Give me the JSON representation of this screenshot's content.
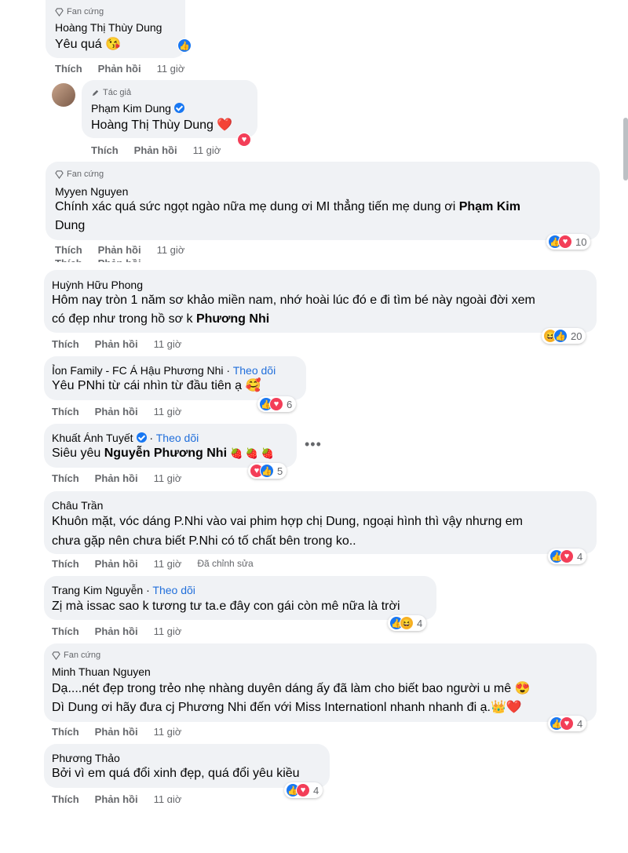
{
  "labels": {
    "like": "Thích",
    "reply": "Phản hồi",
    "follow": "Theo dõi",
    "edited": "Đã chỉnh sửa"
  },
  "comments": [
    {
      "badge": "Fan cứng",
      "name": "Hoàng Thị Thùy Dung",
      "text": "Yêu quá 😘",
      "time": "11 giờ"
    },
    {
      "badge": "Tác giả",
      "name": "Phạm Kim Dung",
      "text": "Hoàng Thị Thùy Dung ❤️",
      "time": "11 giờ"
    },
    {
      "badge": "Fan cứng",
      "name": "Myyen Nguyen",
      "text_line1": "Chính xác quá sức ngọt ngào nữa mẹ dung ơi MI thẳng tiến mẹ dung ơi ",
      "text_mention": "Phạm Kim",
      "text_line2": "Dung",
      "time": "11 giờ",
      "reactions": "10"
    },
    {
      "name": "Huỳnh Hữu Phong",
      "text_line1": "Hôm nay tròn 1 năm sơ khảo miền nam, nhớ hoài lúc đó e đi tìm bé này ngoài đời xem",
      "text_line2": "có đẹp như trong hồ sơ k ",
      "text_mention": "Phương Nhi",
      "time": "11 giờ",
      "reactions": "20"
    },
    {
      "name": "Ỉon Family - FC Á Hậu Phương Nhi",
      "text": "Yêu PNhi từ cái nhìn từ đầu tiên ạ 🥰",
      "time": "11 giờ",
      "reactions": "6"
    },
    {
      "name": "Khuất Ánh Tuyết",
      "text": "Siêu yêu ",
      "text_mention": "Nguyễn Phương Nhi",
      "text_emoji": "🍓 🍓 🍓",
      "time": "11 giờ",
      "reactions": "5"
    },
    {
      "name": "Châu Trần",
      "text_line1": "Khuôn mặt, vóc dáng P.Nhi vào vai phim hợp chị Dung, ngoại hình thì vậy nhưng em",
      "text_line2": "chưa gặp nên chưa biết P.Nhi có tố chất bên trong ko..",
      "time": "11 giờ",
      "reactions": "4"
    },
    {
      "name": "Trang Kim Nguyễn",
      "text": "Zị mà issac sao k tương tư ta.e đây con gái còn mê nữa là trời",
      "time": "11 giờ",
      "reactions": "4"
    },
    {
      "badge": "Fan cứng",
      "name": "Minh Thuan Nguyen",
      "text_line1": "Dạ....nét đẹp trong trẻo nhẹ nhàng duyên dáng ấy đã làm cho biết bao người u mê 😍",
      "text_line2": "Dì Dung ơi hãy đưa cj Phương Nhi đến với Miss Internationl nhanh nhanh đi ạ.👑❤️",
      "time": "11 giờ",
      "reactions": "4"
    },
    {
      "name": "Phương Thảo",
      "text": "Bởi vì em quá đổi xinh đẹp, quá đổi yêu kiều",
      "time": "11 giờ",
      "reactions": "4"
    }
  ]
}
